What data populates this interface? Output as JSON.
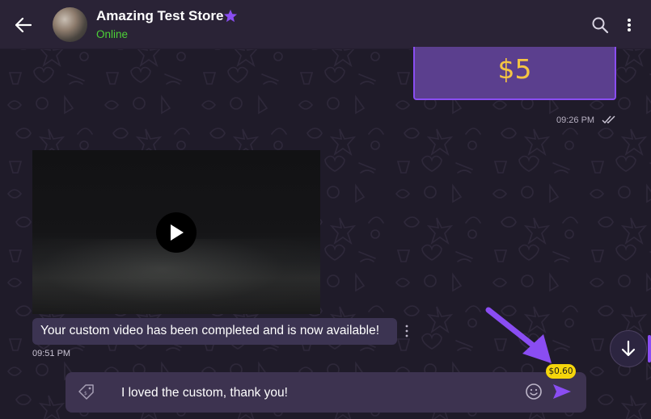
{
  "header": {
    "store_name": "Amazing Test Store",
    "status": "Online",
    "icons": [
      "back-arrow-icon",
      "verified-star-icon",
      "search-icon",
      "more-vertical-icon"
    ]
  },
  "messages": {
    "tip": {
      "amount": "$5",
      "time": "09:26 PM",
      "status_icon": "double-check-icon"
    },
    "video": {
      "icon": "play-icon"
    },
    "text": {
      "body": "Your custom video has been completed and is now available!",
      "time": "09:51 PM"
    }
  },
  "composer": {
    "value": "I loved the custom, thank you!",
    "price": "$0.60",
    "icons": [
      "price-tag-icon",
      "emoji-icon",
      "send-icon"
    ]
  },
  "colors": {
    "accent": "#8a4df2",
    "online": "#4cd137",
    "price_badge": "#f5d60b",
    "tip_text": "#f5c542"
  }
}
